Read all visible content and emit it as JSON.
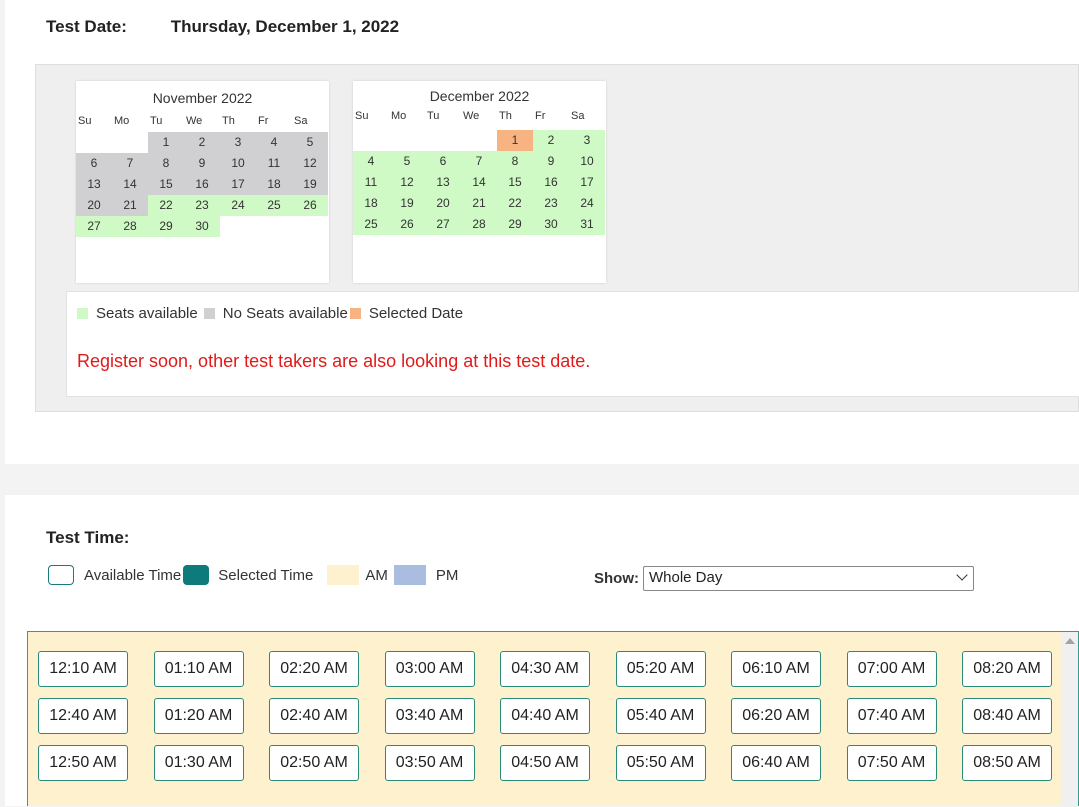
{
  "test_date": {
    "label": "Test Date:",
    "value": "Thursday, December 1, 2022"
  },
  "calendars": [
    {
      "title": "November 2022",
      "weekdays": [
        "Su",
        "Mo",
        "Tu",
        "We",
        "Th",
        "Fr",
        "Sa"
      ],
      "weeks": [
        [
          {
            "d": "",
            "s": "empty"
          },
          {
            "d": "",
            "s": "empty"
          },
          {
            "d": "1",
            "s": "no-seats"
          },
          {
            "d": "2",
            "s": "no-seats"
          },
          {
            "d": "3",
            "s": "no-seats"
          },
          {
            "d": "4",
            "s": "no-seats"
          },
          {
            "d": "5",
            "s": "no-seats"
          }
        ],
        [
          {
            "d": "6",
            "s": "no-seats"
          },
          {
            "d": "7",
            "s": "no-seats"
          },
          {
            "d": "8",
            "s": "no-seats"
          },
          {
            "d": "9",
            "s": "no-seats"
          },
          {
            "d": "10",
            "s": "no-seats"
          },
          {
            "d": "11",
            "s": "no-seats"
          },
          {
            "d": "12",
            "s": "no-seats"
          }
        ],
        [
          {
            "d": "13",
            "s": "no-seats"
          },
          {
            "d": "14",
            "s": "no-seats"
          },
          {
            "d": "15",
            "s": "no-seats"
          },
          {
            "d": "16",
            "s": "no-seats"
          },
          {
            "d": "17",
            "s": "no-seats"
          },
          {
            "d": "18",
            "s": "no-seats"
          },
          {
            "d": "19",
            "s": "no-seats"
          }
        ],
        [
          {
            "d": "20",
            "s": "no-seats"
          },
          {
            "d": "21",
            "s": "no-seats"
          },
          {
            "d": "22",
            "s": "available"
          },
          {
            "d": "23",
            "s": "available"
          },
          {
            "d": "24",
            "s": "available"
          },
          {
            "d": "25",
            "s": "available"
          },
          {
            "d": "26",
            "s": "available"
          }
        ],
        [
          {
            "d": "27",
            "s": "available"
          },
          {
            "d": "28",
            "s": "available"
          },
          {
            "d": "29",
            "s": "available"
          },
          {
            "d": "30",
            "s": "available"
          },
          {
            "d": "",
            "s": "empty"
          },
          {
            "d": "",
            "s": "empty"
          },
          {
            "d": "",
            "s": "empty"
          }
        ]
      ]
    },
    {
      "title": "December 2022",
      "weekdays": [
        "Su",
        "Mo",
        "Tu",
        "We",
        "Th",
        "Fr",
        "Sa"
      ],
      "weeks": [
        [
          {
            "d": "",
            "s": "empty"
          },
          {
            "d": "",
            "s": "empty"
          },
          {
            "d": "",
            "s": "empty"
          },
          {
            "d": "",
            "s": "empty"
          },
          {
            "d": "1",
            "s": "selected"
          },
          {
            "d": "2",
            "s": "available"
          },
          {
            "d": "3",
            "s": "available"
          }
        ],
        [
          {
            "d": "4",
            "s": "available"
          },
          {
            "d": "5",
            "s": "available"
          },
          {
            "d": "6",
            "s": "available"
          },
          {
            "d": "7",
            "s": "available"
          },
          {
            "d": "8",
            "s": "available"
          },
          {
            "d": "9",
            "s": "available"
          },
          {
            "d": "10",
            "s": "available"
          }
        ],
        [
          {
            "d": "11",
            "s": "available"
          },
          {
            "d": "12",
            "s": "available"
          },
          {
            "d": "13",
            "s": "available"
          },
          {
            "d": "14",
            "s": "available"
          },
          {
            "d": "15",
            "s": "available"
          },
          {
            "d": "16",
            "s": "available"
          },
          {
            "d": "17",
            "s": "available"
          }
        ],
        [
          {
            "d": "18",
            "s": "available"
          },
          {
            "d": "19",
            "s": "available"
          },
          {
            "d": "20",
            "s": "available"
          },
          {
            "d": "21",
            "s": "available"
          },
          {
            "d": "22",
            "s": "available"
          },
          {
            "d": "23",
            "s": "available"
          },
          {
            "d": "24",
            "s": "available"
          }
        ],
        [
          {
            "d": "25",
            "s": "available"
          },
          {
            "d": "26",
            "s": "available"
          },
          {
            "d": "27",
            "s": "available"
          },
          {
            "d": "28",
            "s": "available"
          },
          {
            "d": "29",
            "s": "available"
          },
          {
            "d": "30",
            "s": "available"
          },
          {
            "d": "31",
            "s": "available"
          }
        ]
      ]
    }
  ],
  "legend": {
    "seats_available": "Seats available",
    "no_seats": "No Seats available",
    "selected_date": "Selected Date",
    "warning": "Register soon, other test takers are also looking at this test date.",
    "colors": {
      "available": "#cff9c5",
      "no_seats": "#d0d0d2",
      "selected": "#f8b382",
      "warning": "#e01a1a"
    }
  },
  "test_time": {
    "label": "Test Time:",
    "legend": {
      "available": "Available Time",
      "selected": "Selected Time",
      "am": "AM",
      "pm": "PM"
    },
    "show_label": "Show:",
    "show_value": "Whole Day",
    "slots": [
      [
        "12:10 AM",
        "01:10 AM",
        "02:20 AM",
        "03:00 AM",
        "04:30 AM",
        "05:20 AM",
        "06:10 AM",
        "07:00 AM",
        "08:20 AM"
      ],
      [
        "12:40 AM",
        "01:20 AM",
        "02:40 AM",
        "03:40 AM",
        "04:40 AM",
        "05:40 AM",
        "06:20 AM",
        "07:40 AM",
        "08:40 AM"
      ],
      [
        "12:50 AM",
        "01:30 AM",
        "02:50 AM",
        "03:50 AM",
        "04:50 AM",
        "05:50 AM",
        "06:40 AM",
        "07:50 AM",
        "08:50 AM"
      ]
    ]
  }
}
